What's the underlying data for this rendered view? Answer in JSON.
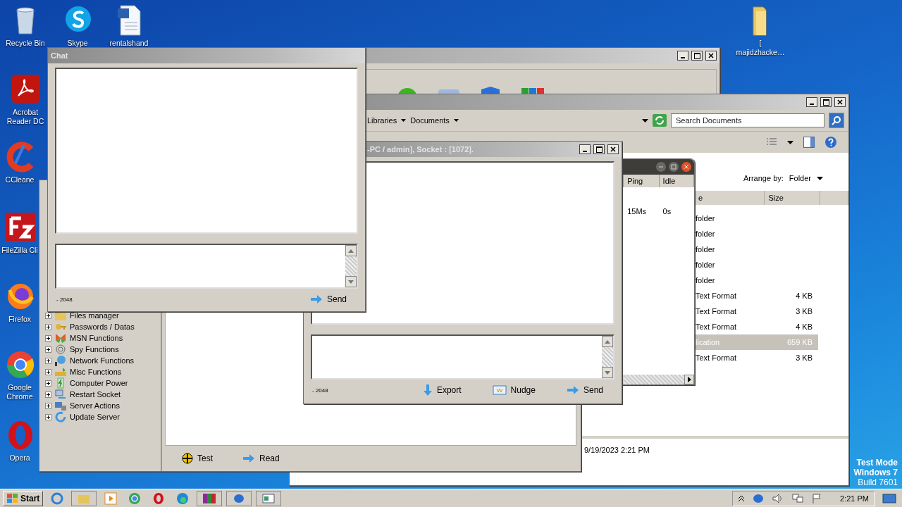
{
  "desktop_icons": [
    {
      "label": "Recycle Bin"
    },
    {
      "label": "Skype"
    },
    {
      "label": "rentalshand"
    },
    {
      "label": "Acrobat Reader DC"
    },
    {
      "label": "CCleane"
    },
    {
      "label": "FileZilla Cli"
    },
    {
      "label": "Firefox"
    },
    {
      "label": "Google Chrome"
    },
    {
      "label": "Opera"
    },
    {
      "label": "[ majidzhacke…"
    }
  ],
  "explorer": {
    "breadcrumbs": [
      "Libraries",
      "Documents"
    ],
    "search": {
      "placeholder": "Search Documents"
    },
    "arrange_label": "Arrange by:",
    "arrange_value": "Folder",
    "columns": [
      "e",
      "Size"
    ],
    "rows": [
      {
        "type": "folder",
        "selected": false
      },
      {
        "type": "folder",
        "selected": false
      },
      {
        "type": "folder",
        "selected": false
      },
      {
        "type": "folder",
        "selected": false
      },
      {
        "type": "folder",
        "selected": false
      },
      {
        "type": "Text Format",
        "size": "4 KB",
        "selected": false
      },
      {
        "type": "Text Format",
        "size": "3 KB",
        "selected": false
      },
      {
        "type": "Text Format",
        "size": "4 KB",
        "selected": false
      },
      {
        "type": "lication",
        "size": "659 KB",
        "selected": true
      },
      {
        "type": "Text Format",
        "size": "3 KB",
        "selected": false
      }
    ],
    "details": "9/19/2023 2:21 PM"
  },
  "rat_panel": {
    "tree": [
      {
        "label": "Files manager",
        "expanded": false
      },
      {
        "label": "Passwords / Datas",
        "expanded": false
      },
      {
        "label": "MSN Functions",
        "expanded": false
      },
      {
        "label": "Spy Functions",
        "expanded": false
      },
      {
        "label": "Network Functions",
        "expanded": false
      },
      {
        "label": "Misc Functions",
        "expanded": false
      },
      {
        "label": "Computer Power",
        "expanded": false
      },
      {
        "label": "Restart Socket",
        "expanded": false
      },
      {
        "label": "Server Actions",
        "expanded": false
      },
      {
        "label": "Update Server",
        "expanded": false
      }
    ],
    "buttons": [
      "Test",
      "Read"
    ]
  },
  "connections": {
    "columns": [
      "Ping",
      "Idle"
    ],
    "rows": [
      {
        "ping": "15Ms",
        "idle": "0s"
      }
    ]
  },
  "socket_chat": {
    "title": "-PC / admin], Socket : [1072].",
    "counter": "- 2048",
    "buttons": [
      "Export",
      "Nudge",
      "Send"
    ]
  },
  "chat": {
    "title": "Chat",
    "counter": "- 2048",
    "buttons": [
      "Send"
    ]
  },
  "taskbar": {
    "start": "Start",
    "clock": "2:21 PM"
  },
  "desktop_note": [
    "Test Mode",
    "Windows 7",
    "Build 7601"
  ]
}
